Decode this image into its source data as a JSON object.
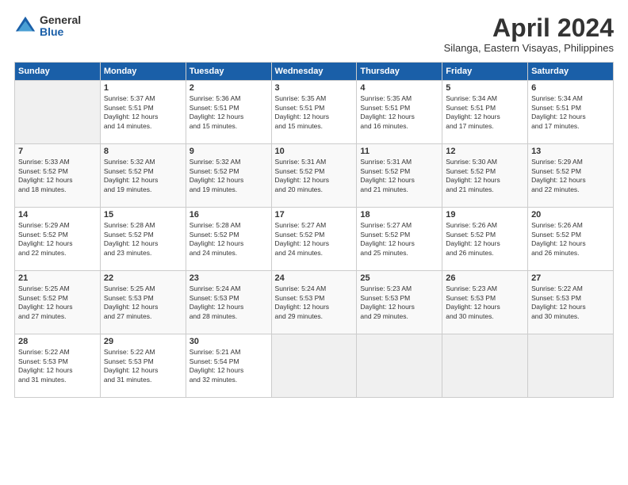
{
  "header": {
    "logo_general": "General",
    "logo_blue": "Blue",
    "month_title": "April 2024",
    "subtitle": "Silanga, Eastern Visayas, Philippines"
  },
  "calendar": {
    "days_of_week": [
      "Sunday",
      "Monday",
      "Tuesday",
      "Wednesday",
      "Thursday",
      "Friday",
      "Saturday"
    ],
    "weeks": [
      [
        {
          "day": "",
          "info": ""
        },
        {
          "day": "1",
          "info": "Sunrise: 5:37 AM\nSunset: 5:51 PM\nDaylight: 12 hours\nand 14 minutes."
        },
        {
          "day": "2",
          "info": "Sunrise: 5:36 AM\nSunset: 5:51 PM\nDaylight: 12 hours\nand 15 minutes."
        },
        {
          "day": "3",
          "info": "Sunrise: 5:35 AM\nSunset: 5:51 PM\nDaylight: 12 hours\nand 15 minutes."
        },
        {
          "day": "4",
          "info": "Sunrise: 5:35 AM\nSunset: 5:51 PM\nDaylight: 12 hours\nand 16 minutes."
        },
        {
          "day": "5",
          "info": "Sunrise: 5:34 AM\nSunset: 5:51 PM\nDaylight: 12 hours\nand 17 minutes."
        },
        {
          "day": "6",
          "info": "Sunrise: 5:34 AM\nSunset: 5:51 PM\nDaylight: 12 hours\nand 17 minutes."
        }
      ],
      [
        {
          "day": "7",
          "info": "Sunrise: 5:33 AM\nSunset: 5:52 PM\nDaylight: 12 hours\nand 18 minutes."
        },
        {
          "day": "8",
          "info": "Sunrise: 5:32 AM\nSunset: 5:52 PM\nDaylight: 12 hours\nand 19 minutes."
        },
        {
          "day": "9",
          "info": "Sunrise: 5:32 AM\nSunset: 5:52 PM\nDaylight: 12 hours\nand 19 minutes."
        },
        {
          "day": "10",
          "info": "Sunrise: 5:31 AM\nSunset: 5:52 PM\nDaylight: 12 hours\nand 20 minutes."
        },
        {
          "day": "11",
          "info": "Sunrise: 5:31 AM\nSunset: 5:52 PM\nDaylight: 12 hours\nand 21 minutes."
        },
        {
          "day": "12",
          "info": "Sunrise: 5:30 AM\nSunset: 5:52 PM\nDaylight: 12 hours\nand 21 minutes."
        },
        {
          "day": "13",
          "info": "Sunrise: 5:29 AM\nSunset: 5:52 PM\nDaylight: 12 hours\nand 22 minutes."
        }
      ],
      [
        {
          "day": "14",
          "info": "Sunrise: 5:29 AM\nSunset: 5:52 PM\nDaylight: 12 hours\nand 22 minutes."
        },
        {
          "day": "15",
          "info": "Sunrise: 5:28 AM\nSunset: 5:52 PM\nDaylight: 12 hours\nand 23 minutes."
        },
        {
          "day": "16",
          "info": "Sunrise: 5:28 AM\nSunset: 5:52 PM\nDaylight: 12 hours\nand 24 minutes."
        },
        {
          "day": "17",
          "info": "Sunrise: 5:27 AM\nSunset: 5:52 PM\nDaylight: 12 hours\nand 24 minutes."
        },
        {
          "day": "18",
          "info": "Sunrise: 5:27 AM\nSunset: 5:52 PM\nDaylight: 12 hours\nand 25 minutes."
        },
        {
          "day": "19",
          "info": "Sunrise: 5:26 AM\nSunset: 5:52 PM\nDaylight: 12 hours\nand 26 minutes."
        },
        {
          "day": "20",
          "info": "Sunrise: 5:26 AM\nSunset: 5:52 PM\nDaylight: 12 hours\nand 26 minutes."
        }
      ],
      [
        {
          "day": "21",
          "info": "Sunrise: 5:25 AM\nSunset: 5:52 PM\nDaylight: 12 hours\nand 27 minutes."
        },
        {
          "day": "22",
          "info": "Sunrise: 5:25 AM\nSunset: 5:53 PM\nDaylight: 12 hours\nand 27 minutes."
        },
        {
          "day": "23",
          "info": "Sunrise: 5:24 AM\nSunset: 5:53 PM\nDaylight: 12 hours\nand 28 minutes."
        },
        {
          "day": "24",
          "info": "Sunrise: 5:24 AM\nSunset: 5:53 PM\nDaylight: 12 hours\nand 29 minutes."
        },
        {
          "day": "25",
          "info": "Sunrise: 5:23 AM\nSunset: 5:53 PM\nDaylight: 12 hours\nand 29 minutes."
        },
        {
          "day": "26",
          "info": "Sunrise: 5:23 AM\nSunset: 5:53 PM\nDaylight: 12 hours\nand 30 minutes."
        },
        {
          "day": "27",
          "info": "Sunrise: 5:22 AM\nSunset: 5:53 PM\nDaylight: 12 hours\nand 30 minutes."
        }
      ],
      [
        {
          "day": "28",
          "info": "Sunrise: 5:22 AM\nSunset: 5:53 PM\nDaylight: 12 hours\nand 31 minutes."
        },
        {
          "day": "29",
          "info": "Sunrise: 5:22 AM\nSunset: 5:53 PM\nDaylight: 12 hours\nand 31 minutes."
        },
        {
          "day": "30",
          "info": "Sunrise: 5:21 AM\nSunset: 5:54 PM\nDaylight: 12 hours\nand 32 minutes."
        },
        {
          "day": "",
          "info": ""
        },
        {
          "day": "",
          "info": ""
        },
        {
          "day": "",
          "info": ""
        },
        {
          "day": "",
          "info": ""
        }
      ]
    ]
  }
}
